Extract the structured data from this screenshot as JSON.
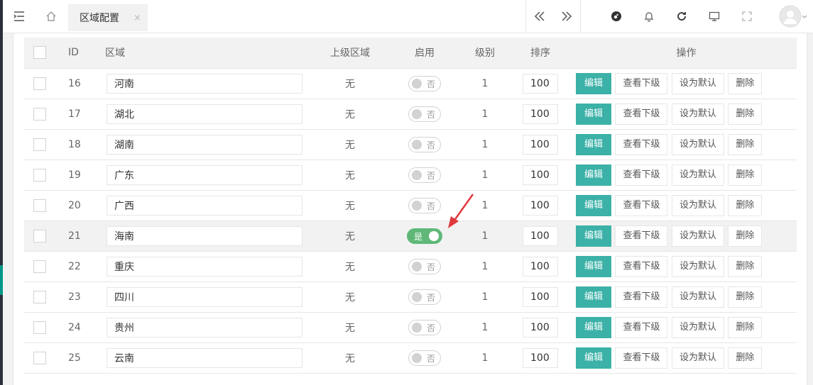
{
  "tabs": [
    {
      "label": "区域配置",
      "close": "×"
    }
  ],
  "table": {
    "headers": {
      "id": "ID",
      "name": "区域",
      "parent": "上级区域",
      "enable": "启用",
      "level": "级别",
      "sort": "排序",
      "ops": "操作"
    },
    "actions": {
      "edit": "编辑",
      "children": "查看下级",
      "default": "设为默认",
      "delete": "删除"
    },
    "switch": {
      "on": "是",
      "off": "否"
    },
    "rows": [
      {
        "id": "16",
        "name": "河南",
        "parent": "无",
        "enabled": false,
        "level": "1",
        "sort": "100"
      },
      {
        "id": "17",
        "name": "湖北",
        "parent": "无",
        "enabled": false,
        "level": "1",
        "sort": "100"
      },
      {
        "id": "18",
        "name": "湖南",
        "parent": "无",
        "enabled": false,
        "level": "1",
        "sort": "100"
      },
      {
        "id": "19",
        "name": "广东",
        "parent": "无",
        "enabled": false,
        "level": "1",
        "sort": "100"
      },
      {
        "id": "20",
        "name": "广西",
        "parent": "无",
        "enabled": false,
        "level": "1",
        "sort": "100"
      },
      {
        "id": "21",
        "name": "海南",
        "parent": "无",
        "enabled": true,
        "level": "1",
        "sort": "100"
      },
      {
        "id": "22",
        "name": "重庆",
        "parent": "无",
        "enabled": false,
        "level": "1",
        "sort": "100"
      },
      {
        "id": "23",
        "name": "四川",
        "parent": "无",
        "enabled": false,
        "level": "1",
        "sort": "100"
      },
      {
        "id": "24",
        "name": "贵州",
        "parent": "无",
        "enabled": false,
        "level": "1",
        "sort": "100"
      },
      {
        "id": "25",
        "name": "云南",
        "parent": "无",
        "enabled": false,
        "level": "1",
        "sort": "100"
      }
    ]
  },
  "colors": {
    "primary": "#3cb1a8",
    "switch_on": "#5fb878",
    "annotation": "#e0393e"
  }
}
